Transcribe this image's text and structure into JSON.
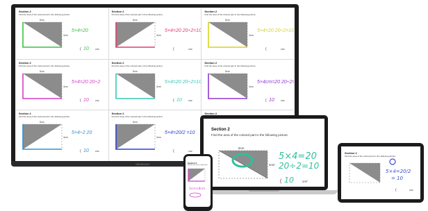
{
  "tv": {
    "brand": "SAMSUNG",
    "cells": [
      {
        "section": "Section 2",
        "instruction": "Find the area of the colored part in the following picture.",
        "dim_top": "5cm",
        "dim_side": "4cm",
        "note": "5×4=20",
        "answer": "10",
        "unit": "cm²",
        "ink": "#3cc23c"
      },
      {
        "section": "Section 2",
        "instruction": "Find the area of the colored part in the following picture.",
        "dim_top": "5cm",
        "dim_side": "4cm",
        "note": "5×4=20 20÷2=10",
        "answer": "",
        "unit": "cm²",
        "ink": "#e23a6b"
      },
      {
        "section": "Section 2",
        "instruction": "Find the area of the colored part in the following picture.",
        "dim_top": "5cm",
        "dim_side": "4cm",
        "note": "5×4=20 20÷2=10",
        "answer": "",
        "unit": "cm²",
        "ink": "#d8d21e"
      },
      {
        "section": "Section 2",
        "instruction": "Find the area of the colored part in the following picture.",
        "dim_top": "5cm",
        "dim_side": "4cm",
        "note": "5×4=20 20÷2",
        "answer": "10",
        "unit": "cm²",
        "ink": "#d23fc6"
      },
      {
        "section": "Section 2",
        "instruction": "Find the area of the colored part in the following picture.",
        "dim_top": "5cm",
        "dim_side": "4cm",
        "note": "5×4=20 20÷2=10",
        "answer": "10",
        "unit": "cm²",
        "ink": "#38c7b5"
      },
      {
        "section": "Section 2",
        "instruction": "Find the area of the colored part in the following picture.",
        "dim_top": "5cm",
        "dim_side": "4cm",
        "note": "5×4cm=20 20÷2=10",
        "answer": "10",
        "unit": "cm²",
        "ink": "#8b3ad1"
      },
      {
        "section": "Section 2",
        "instruction": "Find the area of the colored part in the following picture.",
        "dim_top": "5cm",
        "dim_side": "4cm",
        "note": "5×4÷2 20",
        "answer": "10",
        "unit": "cm²",
        "ink": "#2f8fd6"
      },
      {
        "section": "Section 2",
        "instruction": "Find the area of the colored part in the following picture.",
        "dim_top": "5cm",
        "dim_side": "4cm",
        "note": "5×4=20/2 =10",
        "answer": "",
        "unit": "cm²",
        "ink": "#2a3fcf"
      },
      {
        "section": "Section 2",
        "instruction": "Find the area of the",
        "dim_top": "",
        "dim_side": "",
        "note": "",
        "answer": "",
        "unit": "",
        "ink": "#999999"
      }
    ]
  },
  "laptop": {
    "section": "Section 2",
    "instruction": "Find the area of the colored part in the following picture.",
    "dim_top": "5cm",
    "dim_side": "4cm",
    "note1": "5×4=20",
    "note2": "20÷2=10",
    "answer": "10",
    "unit": "cm²",
    "ink": "#2fbf9a"
  },
  "tablet": {
    "section": "Section 2",
    "instruction": "Find the area of the colored part in the following picture.",
    "note1": "5×4=20/2",
    "note2": "= 10",
    "answer": "10",
    "unit": "cm²",
    "ink": "#3a4ad2"
  },
  "phone": {
    "section": "Section 2",
    "instruction": "Find the area of the colored part.",
    "note": "5cm×4cm",
    "ink": "#d23fc6"
  }
}
